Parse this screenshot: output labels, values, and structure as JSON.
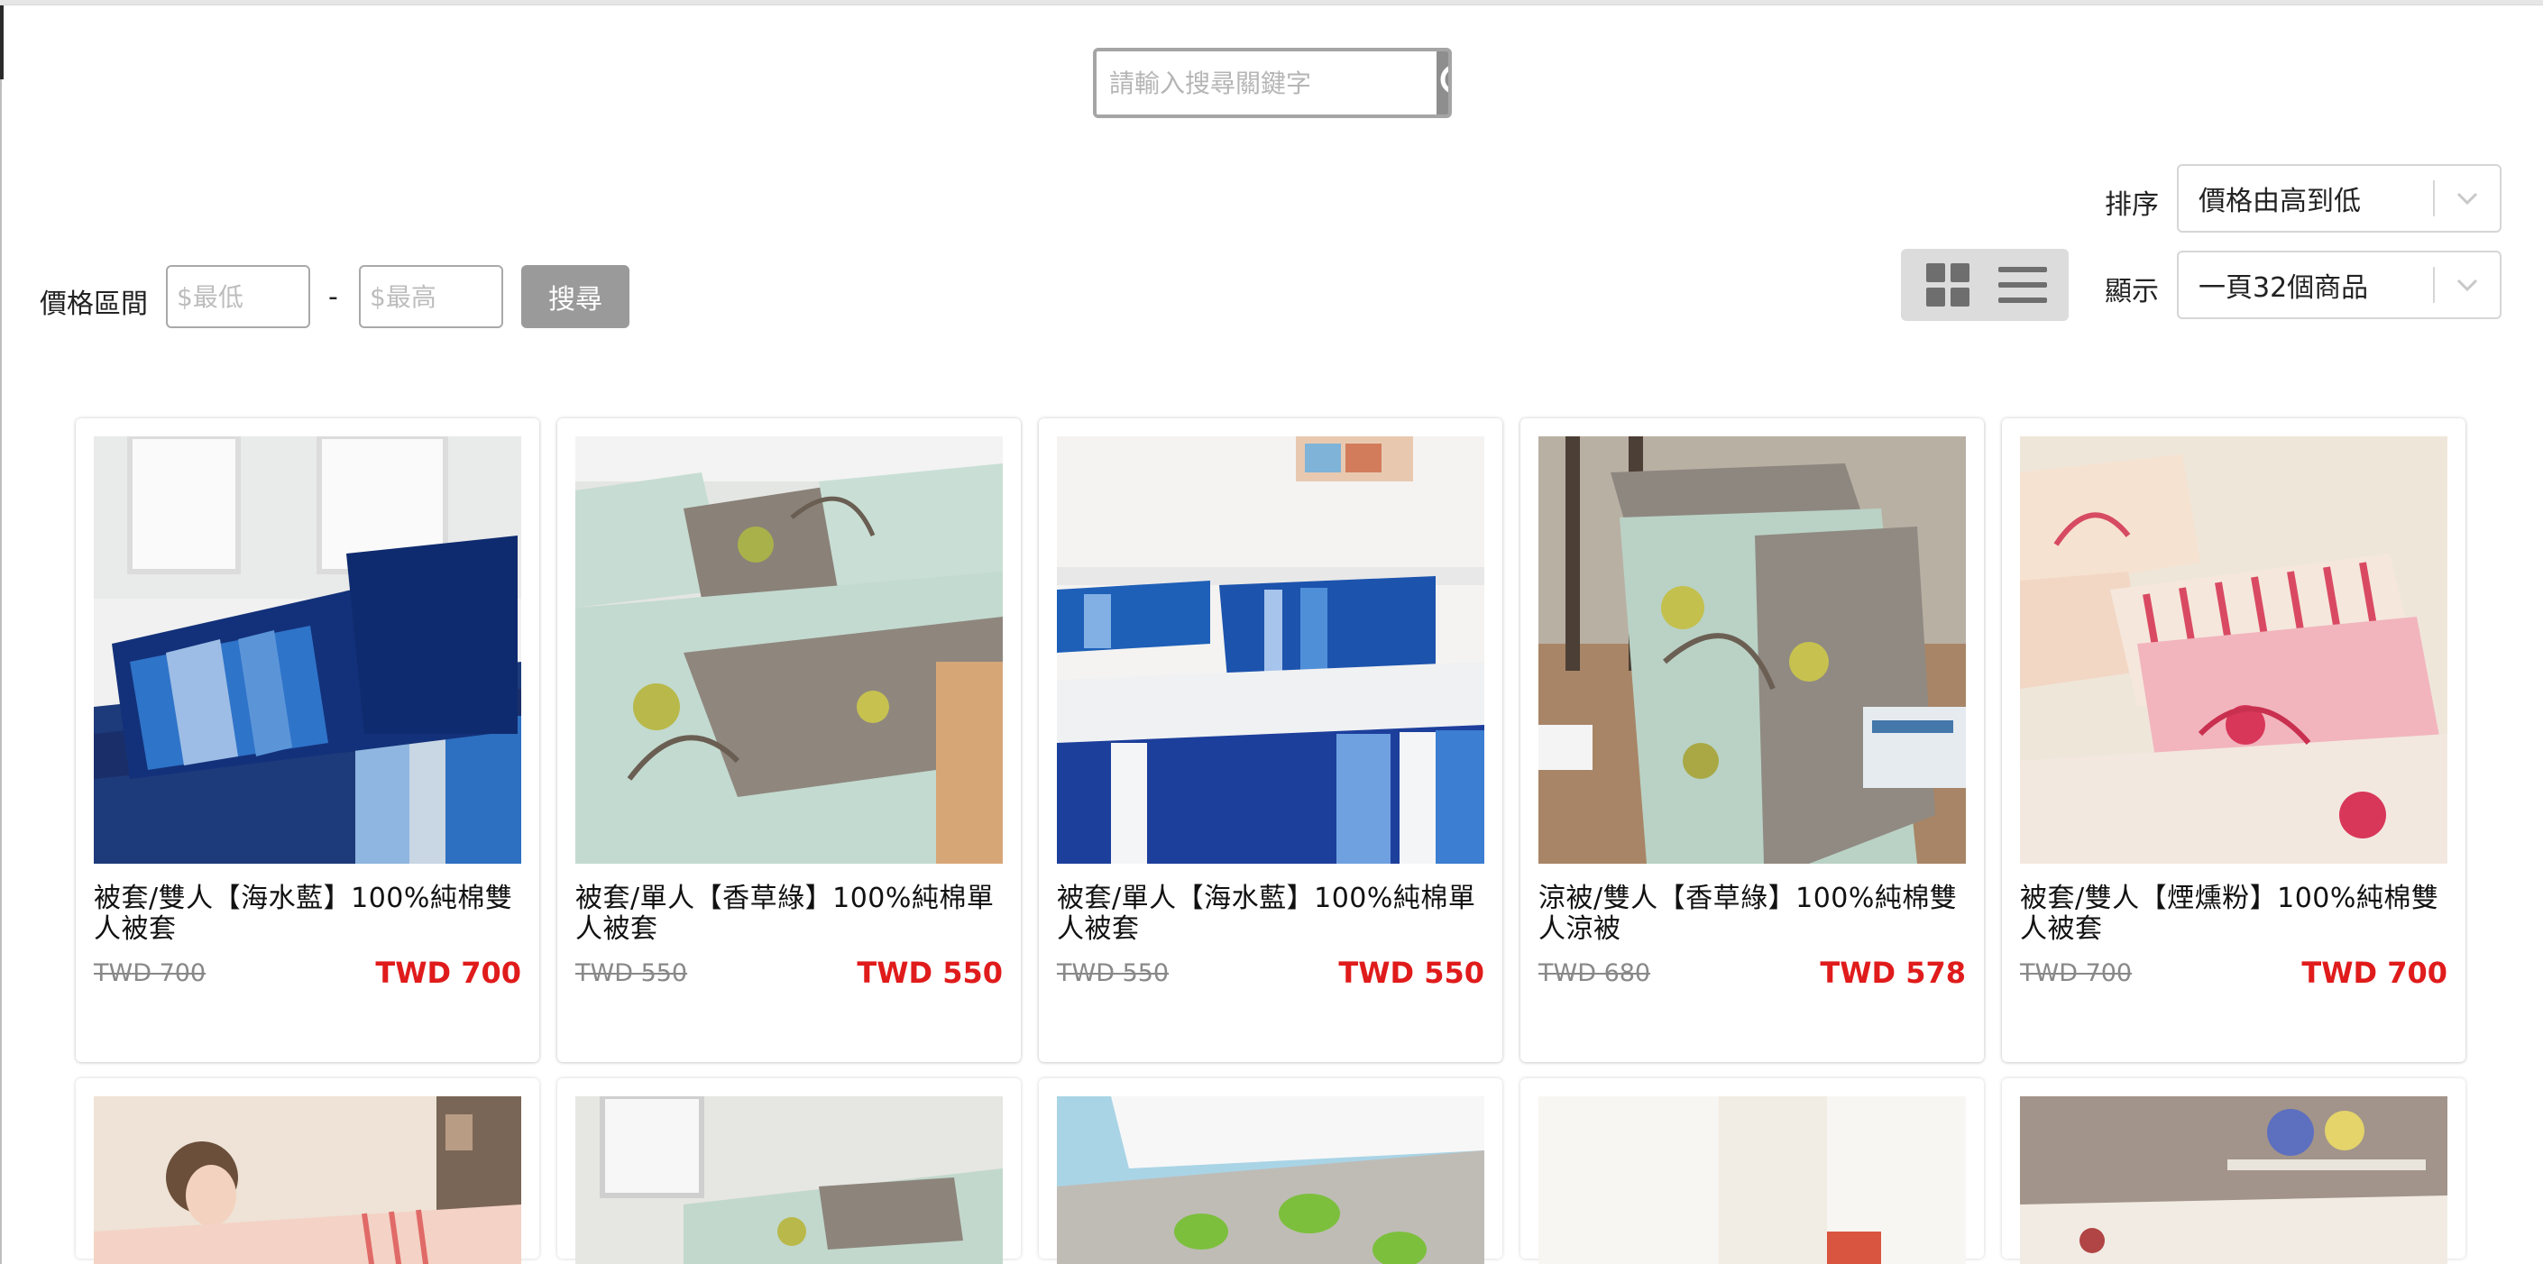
{
  "search": {
    "placeholder": "請輸入搜尋關鍵字",
    "icon": "search-icon"
  },
  "sort": {
    "label": "排序",
    "selected": "價格由高到低"
  },
  "display": {
    "label": "顯示",
    "selected": "一頁32個商品"
  },
  "view_modes": [
    "grid-view-icon",
    "list-view-icon"
  ],
  "price_filter": {
    "label": "價格區間",
    "min_placeholder": "$最低",
    "max_placeholder": "$最高",
    "separator": "-",
    "button": "搜尋"
  },
  "products": [
    {
      "name": "被套/雙人【海水藍】100%純棉雙人被套",
      "old_price": "TWD 700",
      "price": "TWD 700"
    },
    {
      "name": "被套/單人【香草綠】100%純棉單人被套",
      "old_price": "TWD 550",
      "price": "TWD 550"
    },
    {
      "name": "被套/單人【海水藍】100%純棉單人被套",
      "old_price": "TWD 550",
      "price": "TWD 550"
    },
    {
      "name": "涼被/雙人【香草綠】100%純棉雙人涼被",
      "old_price": "TWD 680",
      "price": "TWD 578"
    },
    {
      "name": "被套/雙人【煙燻粉】100%純棉雙人被套",
      "old_price": "TWD 700",
      "price": "TWD 700"
    }
  ],
  "colors": {
    "price_red": "#e01b1b",
    "button_gray": "#9a9a9a",
    "search_btn": "#8e8e8e"
  }
}
